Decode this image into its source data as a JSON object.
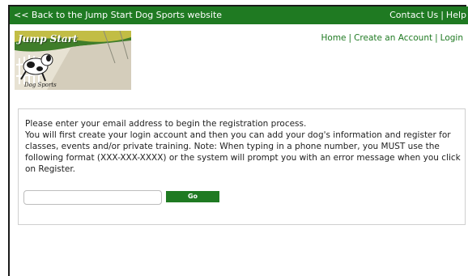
{
  "topbar": {
    "back_link": "<< Back to the Jump Start Dog Sports website",
    "contact": "Contact Us",
    "separator": "|",
    "help": "Help"
  },
  "logo": {
    "title": "Jump Start",
    "subtitle": "Dog Sports",
    "icon": "dog-logo-icon"
  },
  "nav": {
    "home": "Home",
    "create_account": "Create an Account",
    "login": "Login",
    "separator": "|"
  },
  "registration": {
    "line1": "Please enter your email address to begin the registration process.",
    "line2": "You will first create your login account and then you can add your dog's information and register for classes, events and/or private training. Note: When typing in a phone number, you MUST use the following format (XXX-XXX-XXXX) or the system will prompt you with an error message when you click on Register.",
    "email_value": "",
    "email_placeholder": "",
    "go_label": "Go"
  },
  "colors": {
    "brand_green": "#1f7a22",
    "text": "#222222",
    "panel_border": "#cfcfcf"
  }
}
